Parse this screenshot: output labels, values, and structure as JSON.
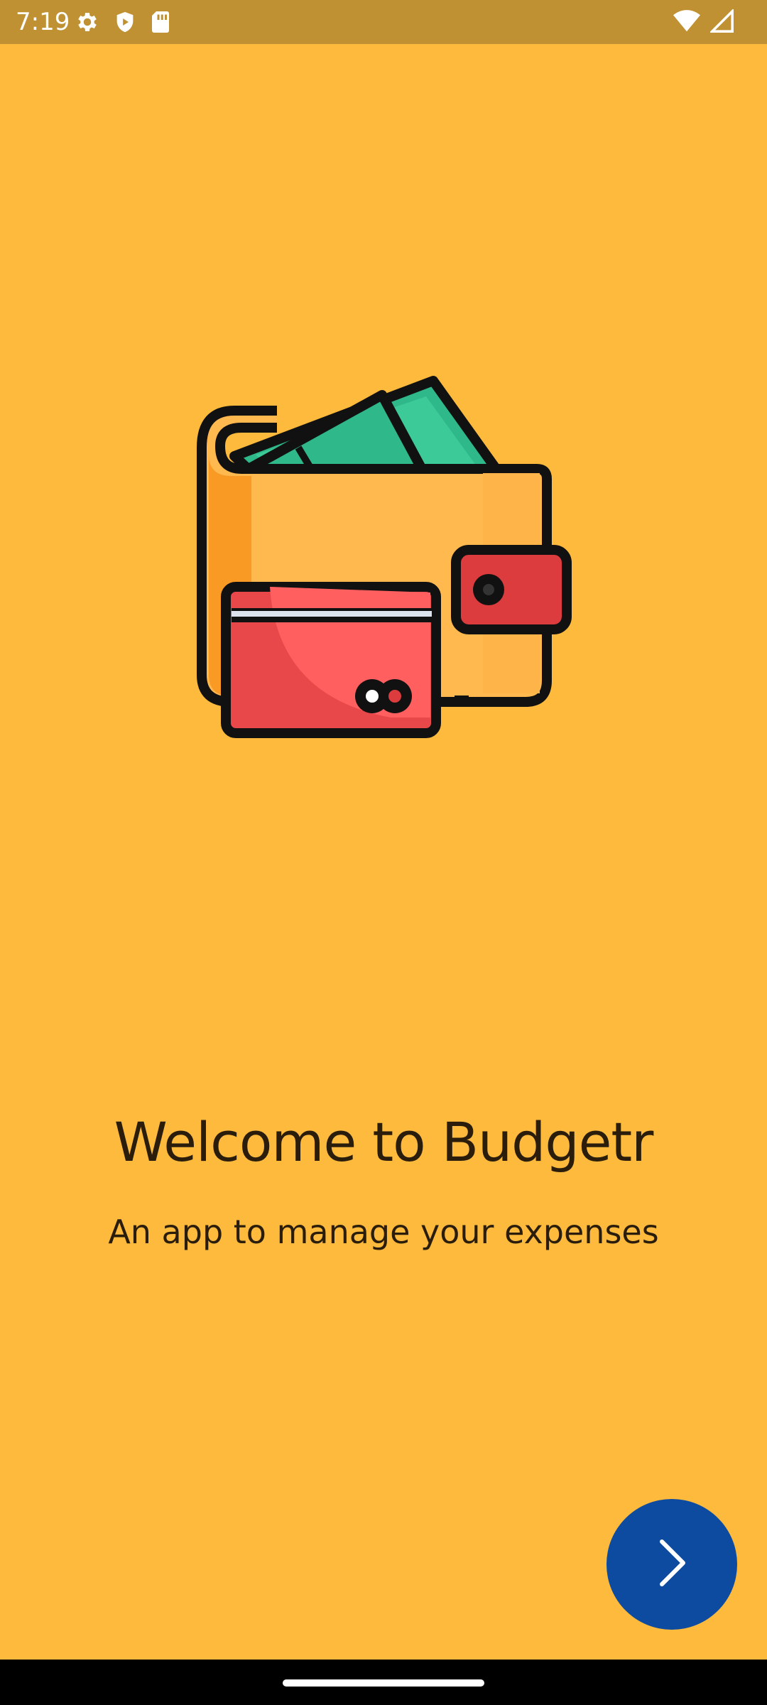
{
  "status_bar": {
    "time": "7:19",
    "left_icons": [
      "settings-icon",
      "shield-play-icon",
      "sd-card-icon"
    ],
    "right_icons": [
      "wifi-icon",
      "signal-icon"
    ]
  },
  "colors": {
    "background": "#FDBA3C",
    "status_bar": "#BF9132",
    "text": "#2A1D0B",
    "next_button": "#0D4BA0",
    "nav_bar": "#000000"
  },
  "illustration": {
    "name": "wallet-with-card-and-cash-illustration"
  },
  "welcome": {
    "title": "Welcome to Budgetr",
    "subtitle": "An app to manage your expenses"
  },
  "next_button": {
    "icon": "chevron-right-icon"
  }
}
